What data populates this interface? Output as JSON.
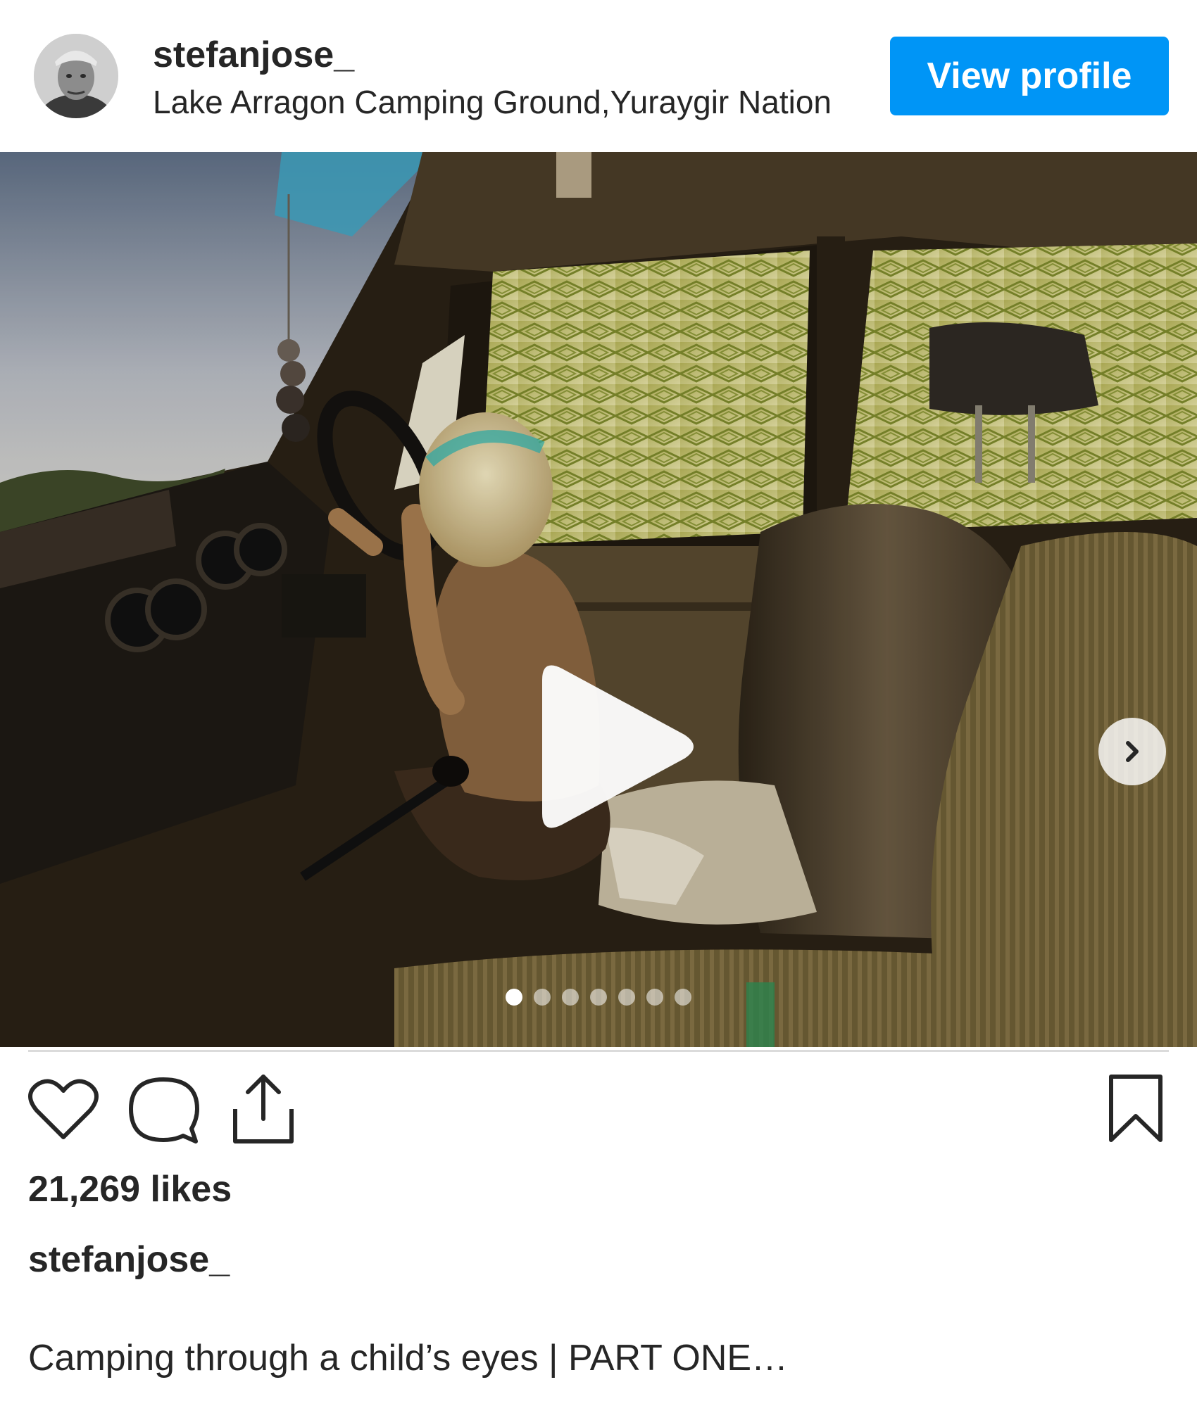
{
  "header": {
    "username": "stefanjose_",
    "location": "Lake Arragon Camping Ground,Yuraygir Nation",
    "view_profile_label": "View profile",
    "avatar_icon": "profile-photo"
  },
  "media": {
    "type": "video",
    "play_icon": "play-icon",
    "next_icon": "chevron-right-icon",
    "carousel_count": 7,
    "carousel_active_index": 0
  },
  "actions": {
    "like_icon": "heart-icon",
    "comment_icon": "comment-icon",
    "share_icon": "share-icon",
    "save_icon": "bookmark-icon"
  },
  "post": {
    "likes": "21,269 likes",
    "caption_username": "stefanjose_",
    "caption_text": "Camping through a child’s eyes | PART ONE…"
  },
  "colors": {
    "accent": "#0095f6",
    "text": "#262626",
    "divider": "#dbdbdb"
  }
}
